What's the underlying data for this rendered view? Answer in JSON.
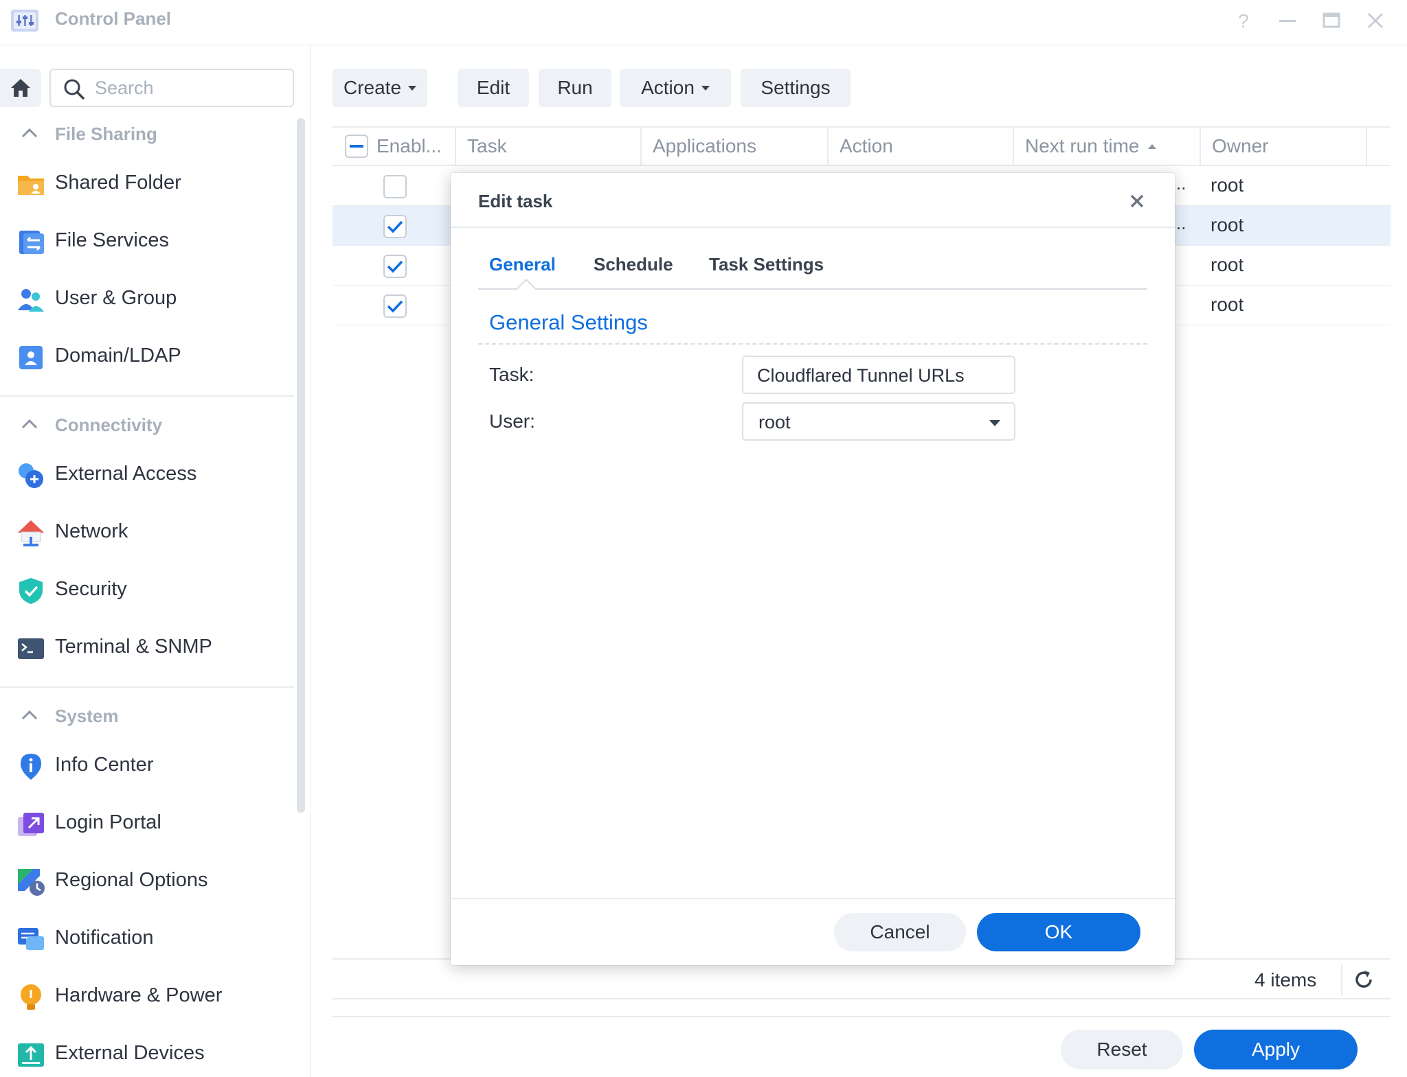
{
  "window": {
    "title": "Control Panel",
    "icons": {
      "help": "help-icon",
      "minimize": "minimize-icon",
      "maximize": "maximize-icon",
      "close": "close-icon"
    }
  },
  "sidebar": {
    "search_placeholder": "Search",
    "groups": [
      {
        "label": "File Sharing",
        "items": [
          {
            "label": "Shared Folder",
            "icon": "shared-folder-icon"
          },
          {
            "label": "File Services",
            "icon": "file-services-icon"
          },
          {
            "label": "User & Group",
            "icon": "user-group-icon"
          },
          {
            "label": "Domain/LDAP",
            "icon": "domain-ldap-icon"
          }
        ]
      },
      {
        "label": "Connectivity",
        "items": [
          {
            "label": "External Access",
            "icon": "external-access-icon"
          },
          {
            "label": "Network",
            "icon": "network-icon"
          },
          {
            "label": "Security",
            "icon": "security-shield-icon"
          },
          {
            "label": "Terminal & SNMP",
            "icon": "terminal-icon"
          }
        ]
      },
      {
        "label": "System",
        "items": [
          {
            "label": "Info Center",
            "icon": "info-center-icon"
          },
          {
            "label": "Login Portal",
            "icon": "login-portal-icon"
          },
          {
            "label": "Regional Options",
            "icon": "regional-options-icon"
          },
          {
            "label": "Notification",
            "icon": "notification-icon"
          },
          {
            "label": "Hardware & Power",
            "icon": "hardware-power-icon"
          },
          {
            "label": "External Devices",
            "icon": "external-devices-icon"
          }
        ]
      }
    ]
  },
  "toolbar": {
    "create": "Create",
    "edit": "Edit",
    "run": "Run",
    "action": "Action",
    "settings": "Settings"
  },
  "grid": {
    "columns": [
      "Enabl...",
      "Task",
      "Applications",
      "Action",
      "Next run time",
      "Owner"
    ],
    "rows": [
      {
        "enabled": false,
        "owner": "root",
        "selected": false,
        "truncated": ".."
      },
      {
        "enabled": true,
        "owner": "root",
        "selected": true,
        "truncated": ".."
      },
      {
        "enabled": true,
        "owner": "root",
        "selected": false,
        "truncated": ""
      },
      {
        "enabled": true,
        "owner": "root",
        "selected": false,
        "truncated": ""
      }
    ],
    "items_count": "4 items"
  },
  "footer": {
    "reset": "Reset",
    "apply": "Apply"
  },
  "modal": {
    "title": "Edit task",
    "tabs": [
      "General",
      "Schedule",
      "Task Settings"
    ],
    "active_tab": "General",
    "section_title": "General Settings",
    "task_label": "Task:",
    "task_value": "Cloudflared Tunnel URLs",
    "user_label": "User:",
    "user_value": "root",
    "cancel": "Cancel",
    "ok": "OK"
  },
  "colors": {
    "accent": "#0f6fde",
    "muted": "#a7b0ba",
    "button_bg": "#eef1f5",
    "selected_row": "#e8f0fb"
  }
}
